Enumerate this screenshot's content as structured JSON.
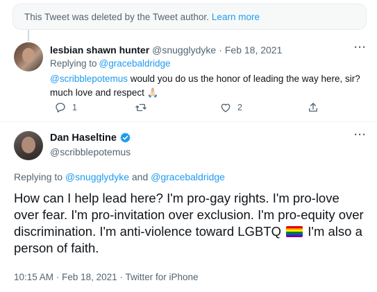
{
  "deleted_notice": {
    "text": "This Tweet was deleted by the Tweet author.",
    "learn_more": "Learn more"
  },
  "reply_tweet": {
    "name": "lesbian shawn hunter",
    "handle": "@snugglydyke",
    "separator": "·",
    "date": "Feb 18, 2021",
    "replying_label": "Replying to",
    "replying_handle": "@gracebaldridge",
    "mention": "@scribblepotemus",
    "text": "would you do us the honor of leading the way here, sir? much love and respect 🙏🏻",
    "more": "···",
    "counts": {
      "replies": "1",
      "retweets": "",
      "likes": "2"
    }
  },
  "main_tweet": {
    "name": "Dan Haseltine",
    "handle": "@scribblepotemus",
    "more": "···",
    "replying_label": "Replying to",
    "replying_handle_1": "@snugglydyke",
    "and_label": "and",
    "replying_handle_2": "@gracebaldridge",
    "text_before_flag": "How can I help lead here?  I'm pro-gay rights.  I'm pro-love over fear.  I'm pro-invitation over exclusion.  I'm pro-equity over discrimination.  I'm anti-violence toward LGBTQ",
    "text_after_flag": "I'm also a person of faith.",
    "flag_icon": "rainbow-flag",
    "time": "10:15 AM",
    "meta_separator": "·",
    "date": "Feb 18, 2021",
    "client": "Twitter for iPhone"
  },
  "colors": {
    "accent": "#1d9bf0",
    "secondary_text": "#536471",
    "primary_text": "#0f1419",
    "notice_bg": "#f7f9f9"
  },
  "icons": [
    "reply-icon",
    "retweet-icon",
    "like-icon",
    "share-icon",
    "verified-badge-icon",
    "more-icon",
    "rainbow-flag-icon"
  ]
}
